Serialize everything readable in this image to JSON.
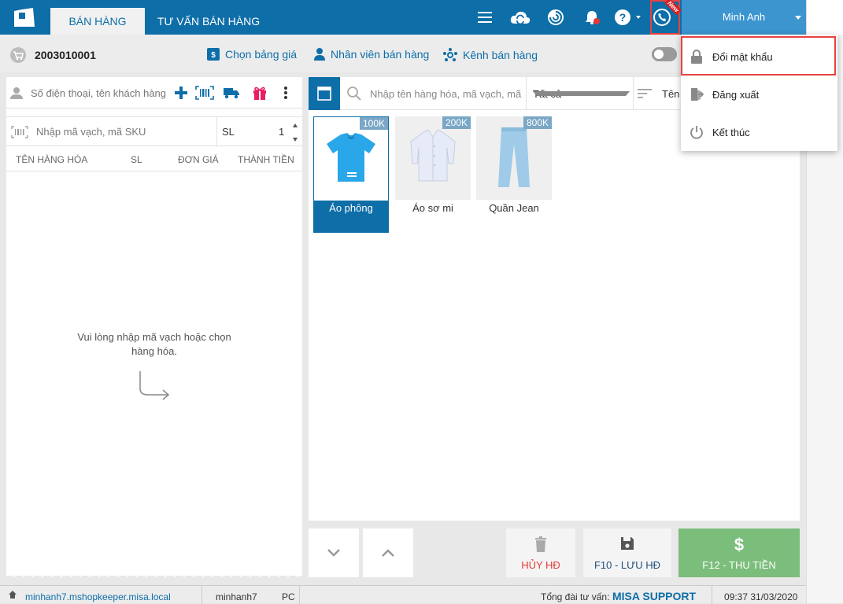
{
  "header": {
    "tabs": [
      {
        "label": "BÁN HÀNG"
      },
      {
        "label": "TƯ VẤN BÁN HÀNG"
      }
    ],
    "new_badge": "New",
    "user": "Minh Anh",
    "accent": "#0e6ea8"
  },
  "toolbar": {
    "order_number": "2003010001",
    "price_list": "Chọn bảng giá",
    "sales_staff": "Nhân viên bán hàng",
    "sales_channel": "Kênh bán hàng"
  },
  "customer": {
    "placeholder": "Số điện thoại, tên khách hàng"
  },
  "sku": {
    "placeholder": "Nhập mã vạch, mã SKU",
    "qty_label": "SL",
    "qty_value": "1"
  },
  "table": {
    "columns": [
      "TÊN HÀNG HÓA",
      "SL",
      "ĐƠN GIÁ",
      "THÀNH TIỀN"
    ]
  },
  "empty": {
    "line1": "Vui lòng nhập mã vạch hoặc chọn",
    "line2": "hàng hóa."
  },
  "products": {
    "search_placeholder": "Nhập tên hàng hóa, mã vạch, mã",
    "category": "Tất cả",
    "sort": "Tên",
    "items": [
      {
        "name": "Áo phông",
        "price": "100K",
        "selected": true
      },
      {
        "name": "Áo sơ mi",
        "price": "200K",
        "selected": false
      },
      {
        "name": "Quần Jean",
        "price": "800K",
        "selected": false
      }
    ]
  },
  "actions": {
    "cancel": "HỦY HĐ",
    "save": "F10 - LƯU HĐ",
    "pay": "F12 - THU TIỀN"
  },
  "menu": {
    "items": [
      {
        "label": "Đổi mật khẩu",
        "icon": "lock-icon"
      },
      {
        "label": "Đăng xuất",
        "icon": "logout-icon"
      },
      {
        "label": "Kết thúc",
        "icon": "power-icon"
      }
    ]
  },
  "status": {
    "domain": "minhanh7.mshopkeeper.misa.local",
    "user": "minhanh7",
    "device": "PC",
    "support_label": "Tổng đài tư vấn:",
    "support_name": "MISA SUPPORT",
    "datetime": "09:37 31/03/2020"
  }
}
